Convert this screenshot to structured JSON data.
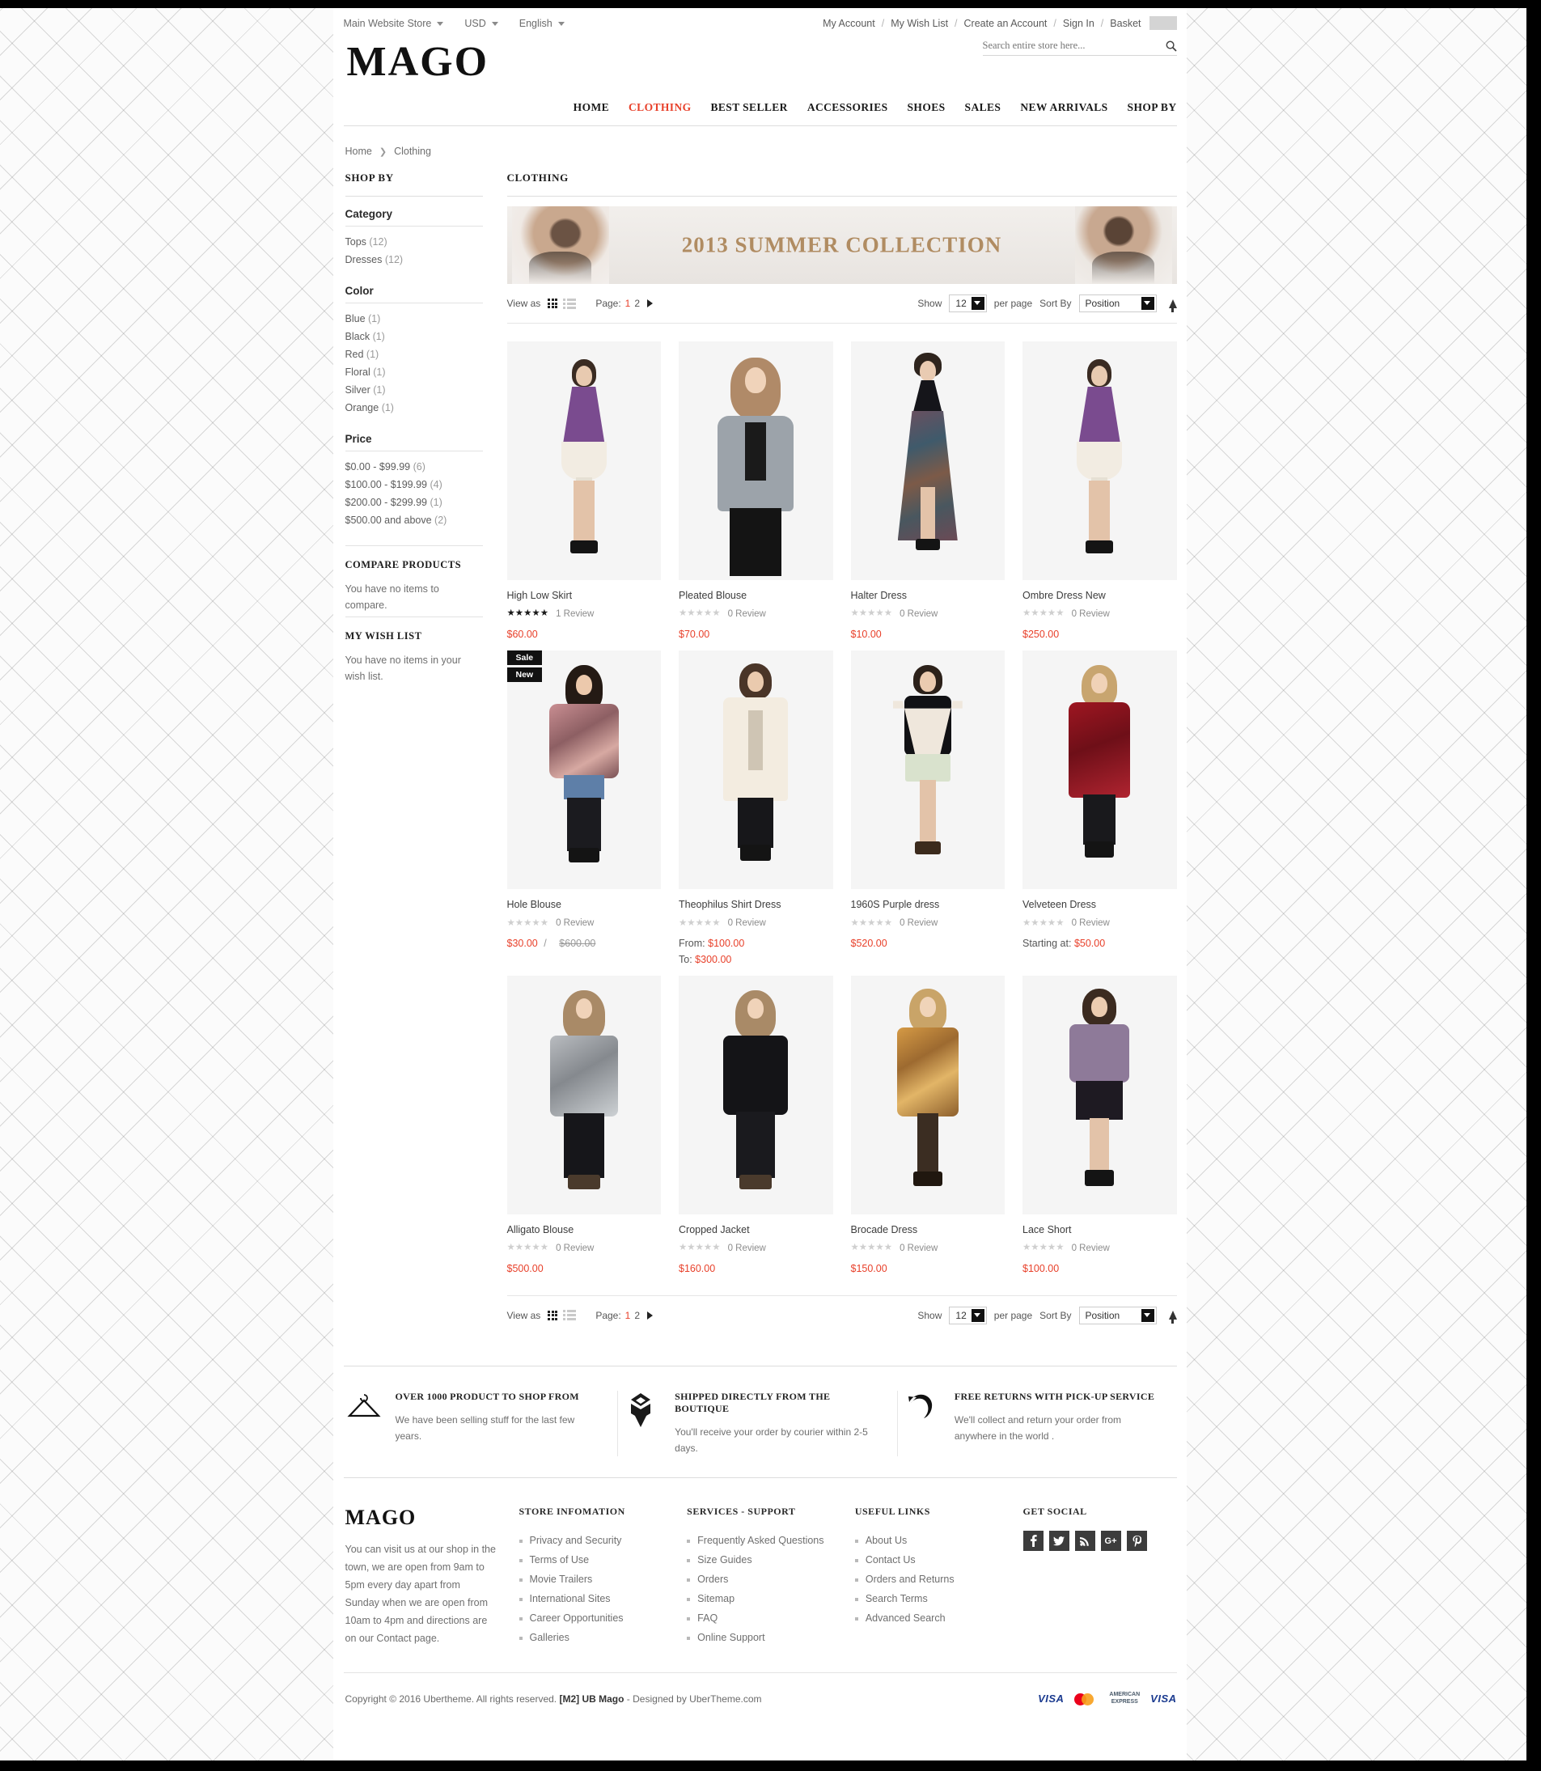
{
  "header": {
    "store_switcher": "Main Website Store",
    "currency": "USD",
    "language": "English",
    "account_links": [
      "My Account",
      "My Wish List",
      "Create an Account",
      "Sign In",
      "Basket"
    ],
    "logo": "MAGO",
    "search_placeholder": "Search entire store here...",
    "search_value": "",
    "nav": [
      {
        "label": "HOME",
        "active": false
      },
      {
        "label": "CLOTHING",
        "active": true
      },
      {
        "label": "BEST SELLER",
        "active": false
      },
      {
        "label": "ACCESSORIES",
        "active": false
      },
      {
        "label": "SHOES",
        "active": false
      },
      {
        "label": "SALES",
        "active": false
      },
      {
        "label": "NEW ARRIVALS",
        "active": false
      },
      {
        "label": "SHOP BY",
        "active": false
      }
    ]
  },
  "breadcrumb": {
    "home": "Home",
    "current": "Clothing"
  },
  "sidebar": {
    "title": "SHOP BY",
    "groups": [
      {
        "heading": "Category",
        "items": [
          {
            "label": "Tops",
            "count": "(12)"
          },
          {
            "label": "Dresses",
            "count": "(12)"
          }
        ]
      },
      {
        "heading": "Color",
        "items": [
          {
            "label": "Blue",
            "count": "(1)"
          },
          {
            "label": "Black",
            "count": "(1)"
          },
          {
            "label": "Red",
            "count": "(1)"
          },
          {
            "label": "Floral",
            "count": "(1)"
          },
          {
            "label": "Silver",
            "count": "(1)"
          },
          {
            "label": "Orange",
            "count": "(1)"
          }
        ]
      },
      {
        "heading": "Price",
        "items": [
          {
            "label": "$0.00 - $99.99",
            "count": "(6)"
          },
          {
            "label": "$100.00 - $199.99",
            "count": "(4)"
          },
          {
            "label": "$200.00 - $299.99",
            "count": "(1)"
          },
          {
            "label": "$500.00 and above",
            "count": "(2)"
          }
        ]
      }
    ],
    "compare": {
      "title": "COMPARE PRODUCTS",
      "text": "You have no items to compare."
    },
    "wishlist": {
      "title": "MY WISH LIST",
      "text": "You have no items in your wish list."
    }
  },
  "main": {
    "category_title": "CLOTHING",
    "banner_text": "2013  SUMMER COLLECTION",
    "toolbar": {
      "view_as": "View as",
      "page_label": "Page:",
      "pages": [
        "1",
        "2"
      ],
      "current_page": "1",
      "show_label": "Show",
      "per_page_value": "12",
      "per_page_label": "per page",
      "sort_label": "Sort By",
      "sort_value": "Position"
    },
    "products": [
      {
        "name": "High Low Skirt",
        "stars_on": 5,
        "reviews": "1 Review",
        "price": "$60.00",
        "badges": [],
        "price_mode": "simple"
      },
      {
        "name": "Pleated Blouse",
        "stars_on": 0,
        "reviews": "0 Review",
        "price": "$70.00",
        "badges": [],
        "price_mode": "simple"
      },
      {
        "name": "Halter Dress",
        "stars_on": 0,
        "reviews": "0 Review",
        "price": "$10.00",
        "badges": [],
        "price_mode": "simple"
      },
      {
        "name": "Ombre Dress New",
        "stars_on": 0,
        "reviews": "0 Review",
        "price": "$250.00",
        "badges": [],
        "price_mode": "simple"
      },
      {
        "name": "Hole Blouse",
        "stars_on": 0,
        "reviews": "0 Review",
        "price": "$30.00",
        "old_price": "$600.00",
        "badges": [
          "Sale",
          "New"
        ],
        "price_mode": "special"
      },
      {
        "name": "Theophilus Shirt Dress",
        "stars_on": 0,
        "reviews": "0 Review",
        "price_from_label": "From:",
        "price_from": "$100.00",
        "price_to_label": "To:",
        "price_to": "$300.00",
        "badges": [],
        "price_mode": "range"
      },
      {
        "name": "1960S Purple dress",
        "stars_on": 0,
        "reviews": "0 Review",
        "price": "$520.00",
        "badges": [],
        "price_mode": "simple"
      },
      {
        "name": "Velveteen Dress",
        "stars_on": 0,
        "reviews": "0 Review",
        "starting_label": "Starting at:",
        "price": "$50.00",
        "badges": [],
        "price_mode": "starting"
      },
      {
        "name": "Alligato Blouse",
        "stars_on": 0,
        "reviews": "0 Review",
        "price": "$500.00",
        "badges": [],
        "price_mode": "simple"
      },
      {
        "name": "Cropped Jacket",
        "stars_on": 0,
        "reviews": "0 Review",
        "price": "$160.00",
        "badges": [],
        "price_mode": "simple"
      },
      {
        "name": "Brocade Dress",
        "stars_on": 0,
        "reviews": "0 Review",
        "price": "$150.00",
        "badges": [],
        "price_mode": "simple"
      },
      {
        "name": "Lace Short",
        "stars_on": 0,
        "reviews": "0 Review",
        "price": "$100.00",
        "badges": [],
        "price_mode": "simple"
      }
    ]
  },
  "services": [
    {
      "icon": "hanger-icon",
      "title": "OVER 1000 PRODUCT TO SHOP FROM",
      "text": "We have been selling stuff for the last few years."
    },
    {
      "icon": "package-icon",
      "title": "SHIPPED DIRECTLY FROM THE BOUTIQUE",
      "text": "You'll receive your order by courier within 2-5 days."
    },
    {
      "icon": "return-arrow-icon",
      "title": "FREE RETURNS WITH PICK-UP SERVICE",
      "text": "We'll collect and return your order from anywhere in the world ."
    }
  ],
  "footer": {
    "logo": "MAGO",
    "description": "You can visit us at our shop in the town, we are open from 9am to 5pm every day apart from Sunday when we are open from 10am to 4pm and directions are on our Contact page.",
    "columns": [
      {
        "title": "STORE INFOMATION",
        "links": [
          "Privacy and Security",
          "Terms of Use",
          "Movie Trailers",
          "International Sites",
          "Career Opportunities",
          "Galleries"
        ]
      },
      {
        "title": "SERVICES - SUPPORT",
        "links": [
          "Frequently Asked Questions",
          "Size Guides",
          "Orders",
          "Sitemap",
          "FAQ",
          "Online Support"
        ]
      },
      {
        "title": "USEFUL LINKS",
        "links": [
          "About Us",
          "Contact Us",
          "Orders and Returns",
          "Search Terms",
          "Advanced Search"
        ]
      }
    ],
    "social": {
      "title": "GET SOCIAL",
      "icons": [
        {
          "name": "facebook-icon",
          "glyph": "f"
        },
        {
          "name": "twitter-icon",
          "glyph": "✒"
        },
        {
          "name": "rss-icon",
          "glyph": "◤"
        },
        {
          "name": "google-plus-icon",
          "glyph": "G+"
        },
        {
          "name": "pinterest-icon",
          "glyph": "р"
        }
      ]
    },
    "copyright": "Copyright © 2016 Ubertheme. All rights reserved. ",
    "copyright_brand": "[M2] UB Mago",
    "copyright_tail": " - Designed by UberTheme.com",
    "payments": [
      "VISA",
      "mastercard",
      "AMERICAN EXPRESS",
      "VISA"
    ]
  },
  "colors": {
    "accent": "#e8402a",
    "banner_text": "#b08c62",
    "badge_bg": "#111111"
  }
}
